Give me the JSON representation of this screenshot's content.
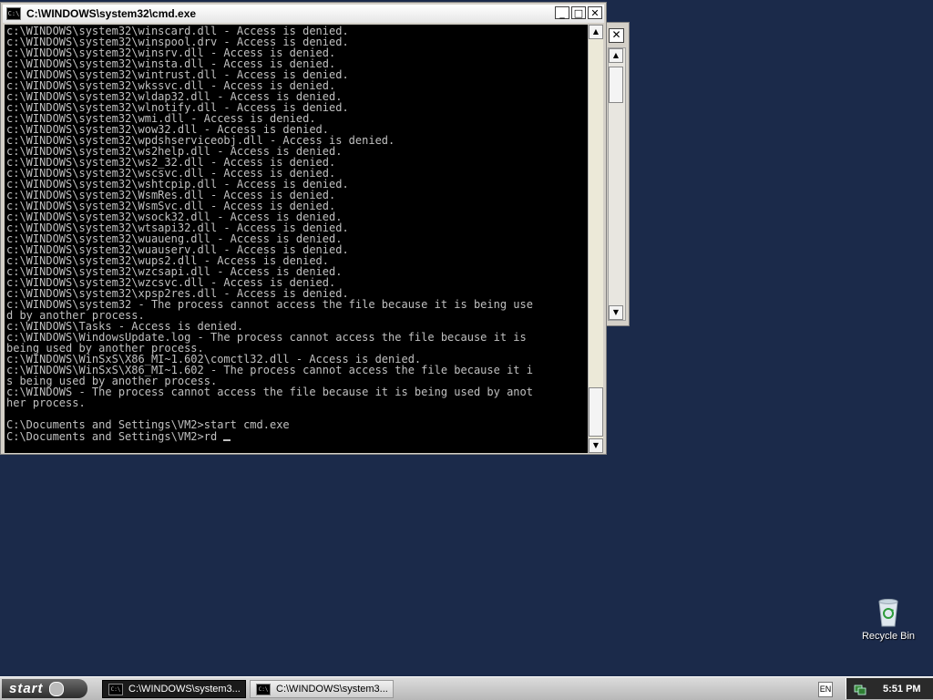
{
  "window": {
    "title": "C:\\WINDOWS\\system32\\cmd.exe",
    "icon": "cmd-icon",
    "console_lines": [
      "c:\\WINDOWS\\system32\\winscard.dll - Access is denied.",
      "c:\\WINDOWS\\system32\\winspool.drv - Access is denied.",
      "c:\\WINDOWS\\system32\\winsrv.dll - Access is denied.",
      "c:\\WINDOWS\\system32\\winsta.dll - Access is denied.",
      "c:\\WINDOWS\\system32\\wintrust.dll - Access is denied.",
      "c:\\WINDOWS\\system32\\wkssvc.dll - Access is denied.",
      "c:\\WINDOWS\\system32\\wldap32.dll - Access is denied.",
      "c:\\WINDOWS\\system32\\wlnotify.dll - Access is denied.",
      "c:\\WINDOWS\\system32\\wmi.dll - Access is denied.",
      "c:\\WINDOWS\\system32\\wow32.dll - Access is denied.",
      "c:\\WINDOWS\\system32\\wpdshserviceobj.dll - Access is denied.",
      "c:\\WINDOWS\\system32\\ws2help.dll - Access is denied.",
      "c:\\WINDOWS\\system32\\ws2_32.dll - Access is denied.",
      "c:\\WINDOWS\\system32\\wscsvc.dll - Access is denied.",
      "c:\\WINDOWS\\system32\\wshtcpip.dll - Access is denied.",
      "c:\\WINDOWS\\system32\\WsmRes.dll - Access is denied.",
      "c:\\WINDOWS\\system32\\WsmSvc.dll - Access is denied.",
      "c:\\WINDOWS\\system32\\wsock32.dll - Access is denied.",
      "c:\\WINDOWS\\system32\\wtsapi32.dll - Access is denied.",
      "c:\\WINDOWS\\system32\\wuaueng.dll - Access is denied.",
      "c:\\WINDOWS\\system32\\wuauserv.dll - Access is denied.",
      "c:\\WINDOWS\\system32\\wups2.dll - Access is denied.",
      "c:\\WINDOWS\\system32\\wzcsapi.dll - Access is denied.",
      "c:\\WINDOWS\\system32\\wzcsvc.dll - Access is denied.",
      "c:\\WINDOWS\\system32\\xpsp2res.dll - Access is denied.",
      "c:\\WINDOWS\\system32 - The process cannot access the file because it is being use",
      "d by another process.",
      "c:\\WINDOWS\\Tasks - Access is denied.",
      "c:\\WINDOWS\\WindowsUpdate.log - The process cannot access the file because it is",
      "being used by another process.",
      "c:\\WINDOWS\\WinSxS\\X86_MI~1.602\\comctl32.dll - Access is denied.",
      "c:\\WINDOWS\\WinSxS\\X86_MI~1.602 - The process cannot access the file because it i",
      "s being used by another process.",
      "c:\\WINDOWS - The process cannot access the file because it is being used by anot",
      "her process.",
      "",
      "C:\\Documents and Settings\\VM2>start cmd.exe",
      ""
    ],
    "prompt_line": "C:\\Documents and Settings\\VM2>rd "
  },
  "buttons": {
    "minimize": "_",
    "maximize": "□",
    "close": "✕",
    "back_close": "✕",
    "scroll_up": "▲",
    "scroll_down": "▼"
  },
  "desktop": {
    "recycle_bin_label": "Recycle Bin"
  },
  "taskbar": {
    "start_label": "start",
    "tasks": [
      {
        "label": "C:\\WINDOWS\\system3...",
        "active": true
      },
      {
        "label": "C:\\WINDOWS\\system3...",
        "active": false
      }
    ],
    "language": "EN",
    "clock": "5:51 PM"
  },
  "colors": {
    "desktop": "#1b2a4a",
    "console_bg": "#000000",
    "console_fg": "#c0c0c0"
  }
}
